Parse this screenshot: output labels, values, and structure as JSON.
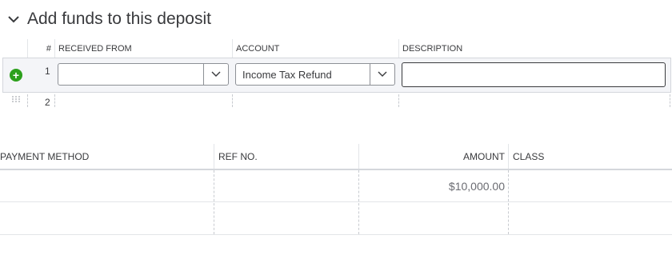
{
  "section": {
    "title": "Add funds to this deposit"
  },
  "top_table": {
    "headers": {
      "num": "#",
      "received_from": "RECEIVED FROM",
      "account": "ACCOUNT",
      "description": "DESCRIPTION"
    },
    "rows": [
      {
        "num": "1",
        "received_from": "",
        "account": "Income Tax Refund",
        "description": ""
      },
      {
        "num": "2",
        "received_from": "",
        "account": "",
        "description": ""
      }
    ]
  },
  "bottom_table": {
    "headers": {
      "payment_method": "PAYMENT METHOD",
      "ref_no": "REF NO.",
      "amount": "AMOUNT",
      "class": "CLASS"
    },
    "rows": [
      {
        "payment_method": "",
        "ref_no": "",
        "amount": "$10,000.00",
        "class": ""
      },
      {
        "payment_method": "",
        "ref_no": "",
        "amount": "",
        "class": ""
      }
    ]
  },
  "colors": {
    "accent_green": "#2ca01c",
    "text": "#393a3d",
    "border": "#d4d7dc"
  },
  "icons": {
    "collapse": "chevron-down-icon",
    "add_row": "plus-circle-icon",
    "drag": "drag-handle-icon",
    "dropdown": "chevron-down-icon"
  }
}
